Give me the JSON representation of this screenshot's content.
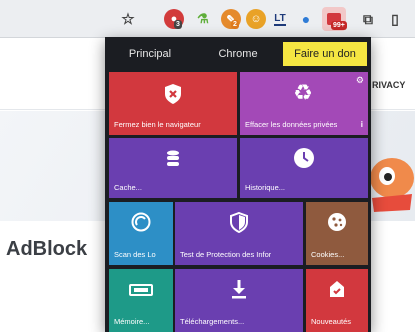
{
  "toolbar": {
    "star_icon": "star-icon",
    "ext_badge_1": "3",
    "ext_badge_2": "2",
    "ext_badge_active": "99+",
    "ext_lt_label": "LT"
  },
  "page": {
    "nav_privacy": "RIVACY",
    "heading": "AdBlock"
  },
  "popup": {
    "tabs": [
      {
        "label": "Principal"
      },
      {
        "label": "Chrome"
      },
      {
        "label": "Faire un don"
      }
    ],
    "tiles": [
      {
        "label": "Fermez bien le navigateur",
        "icon": "shield-x-icon",
        "color": "#d2383e"
      },
      {
        "label": "Effacer les données privées",
        "icon": "recycle-icon",
        "color": "#a349b7"
      },
      {
        "label": "Cache...",
        "icon": "database-icon",
        "color": "#6a3fb0"
      },
      {
        "label": "Historique...",
        "icon": "clock-icon",
        "color": "#6a3fb0"
      },
      {
        "label": "Scan des Lo",
        "icon": "scan-icon",
        "color": "#2d8fc6"
      },
      {
        "label": "Test de Protection des Infor",
        "icon": "shield-icon",
        "color": "#6a3fb0"
      },
      {
        "label": "Cookies...",
        "icon": "cookie-icon",
        "color": "#8f5a3e"
      },
      {
        "label": "Mémoire...",
        "icon": "memory-icon",
        "color": "#1e9a88"
      },
      {
        "label": "Téléchargements...",
        "icon": "download-icon",
        "color": "#6a3fb0"
      },
      {
        "label": "Nouveautés",
        "icon": "new-icon",
        "color": "#d2383e"
      }
    ]
  }
}
